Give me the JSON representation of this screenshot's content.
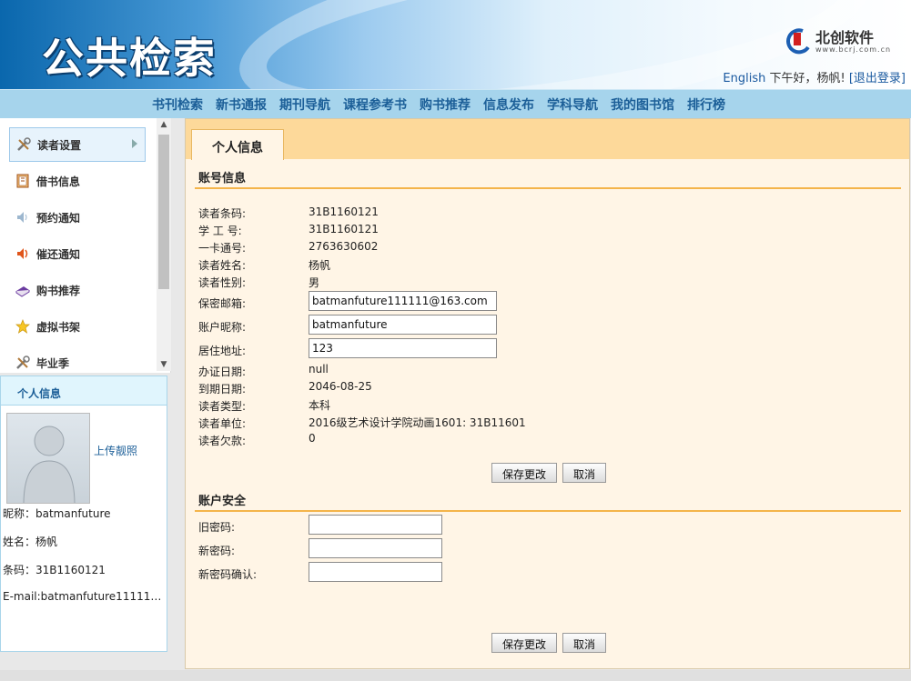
{
  "header": {
    "site_title": "公共检索",
    "brand_name": "北创软件",
    "brand_url": "www.bcrj.com.cn",
    "english_link": "English",
    "greeting": "下午好，杨帆!",
    "logout": "[退出登录]"
  },
  "nav": {
    "items": [
      "书刊检索",
      "新书通报",
      "期刊导航",
      "课程参考书",
      "购书推荐",
      "信息发布",
      "学科导航",
      "我的图书馆",
      "排行榜"
    ]
  },
  "sidebar": {
    "items": [
      {
        "label": "读者设置",
        "icon": "tools-icon"
      },
      {
        "label": "借书信息",
        "icon": "book-icon"
      },
      {
        "label": "预约通知",
        "icon": "speaker-icon"
      },
      {
        "label": "催还通知",
        "icon": "loud-speaker-icon"
      },
      {
        "label": "购书推荐",
        "icon": "purple-book-icon"
      },
      {
        "label": "虚拟书架",
        "icon": "star-icon"
      },
      {
        "label": "毕业季",
        "icon": "tools-icon"
      }
    ]
  },
  "profile": {
    "title": "个人信息",
    "upload": "上传靓照",
    "nickname_line": "昵称：batmanfuture",
    "name_line": "姓名：杨帆",
    "barcode_line": "条码：31B1160121",
    "email_line": "E-mail:batmanfuture111111..."
  },
  "main": {
    "tab": "个人信息",
    "account_section": "账号信息",
    "fields": {
      "barcode_label": "读者条码:",
      "barcode": "31B1160121",
      "student_id_label": "学 工 号:",
      "student_id": "31B1160121",
      "card_label": "一卡通号:",
      "card": "2763630602",
      "name_label": "读者姓名:",
      "name": "杨帆",
      "gender_label": "读者性别:",
      "gender": "男",
      "email_label": "保密邮箱:",
      "email": "batmanfuture111111@163.com",
      "nickname_label": "账户昵称:",
      "nickname": "batmanfuture",
      "address_label": "居住地址:",
      "address": "123",
      "issue_label": "办证日期:",
      "issue": "null",
      "expire_label": "到期日期:",
      "expire": "2046-08-25",
      "type_label": "读者类型:",
      "type": "本科",
      "unit_label": "读者单位:",
      "unit": "2016级艺术设计学院动画1601: 31B11601",
      "debt_label": "读者欠款:",
      "debt": "0"
    },
    "save_label": "保存更改",
    "cancel_label": "取消",
    "security_section": "账户安全",
    "old_pwd_label": "旧密码:",
    "new_pwd_label": "新密码:",
    "confirm_pwd_label": "新密码确认:"
  }
}
